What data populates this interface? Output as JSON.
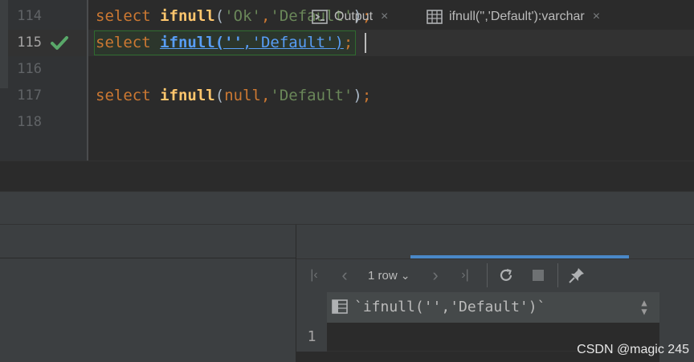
{
  "editor": {
    "lines": [
      {
        "number": "114",
        "tokens": [
          {
            "t": "select",
            "c": "kw"
          },
          {
            "t": " ",
            "c": "punc"
          },
          {
            "t": "ifnull",
            "c": "fn"
          },
          {
            "t": "(",
            "c": "punc"
          },
          {
            "t": "'Ok'",
            "c": "str"
          },
          {
            "t": ",",
            "c": "kw"
          },
          {
            "t": "'Default'",
            "c": "str"
          },
          {
            "t": ")",
            "c": "punc"
          },
          {
            "t": ";",
            "c": "semi"
          }
        ]
      },
      {
        "number": "115",
        "tokens": [
          {
            "t": "select",
            "c": "kw"
          },
          {
            "t": " ",
            "c": "punc"
          },
          {
            "t": "ifnull(''",
            "c": "fn-link"
          },
          {
            "t": ",",
            "c": "link-seg"
          },
          {
            "t": "'Default')",
            "c": "link-seg"
          },
          {
            "t": ";",
            "c": "semi"
          }
        ]
      },
      {
        "number": "116",
        "tokens": []
      },
      {
        "number": "117",
        "tokens": [
          {
            "t": "select",
            "c": "kw"
          },
          {
            "t": " ",
            "c": "punc"
          },
          {
            "t": "ifnull",
            "c": "fn"
          },
          {
            "t": "(",
            "c": "punc"
          },
          {
            "t": "null",
            "c": "kw"
          },
          {
            "t": ",",
            "c": "kw"
          },
          {
            "t": "'Default'",
            "c": "str"
          },
          {
            "t": ")",
            "c": "punc"
          },
          {
            "t": ";",
            "c": "semi"
          }
        ]
      },
      {
        "number": "118",
        "tokens": []
      }
    ],
    "current_line": "115",
    "run_status_icon": "check-icon"
  },
  "tool_window": {
    "tabs": [
      {
        "label": "Output",
        "icon": "console-output-icon",
        "close": "×"
      },
      {
        "label": "ifnull('','Default'):varchar",
        "icon": "table-grid-icon",
        "close": "×",
        "active": true
      }
    ],
    "toolbar": {
      "first_page": "|‹",
      "prev": "‹",
      "rows": "1 row",
      "rows_chevron": "⌄",
      "next": "›",
      "last_page": "›|",
      "reload_icon": "reload-icon",
      "stop_icon": "stop-icon",
      "pin_icon": "pin-icon"
    },
    "grid": {
      "column_header": "`ifnull('','Default')`",
      "row_numbers": [
        "1"
      ],
      "cells": [
        ""
      ]
    }
  },
  "watermark": "CSDN @magic 245",
  "colors": {
    "keyword": "#cc7832",
    "function": "#ffc66d",
    "string": "#6a8759",
    "link": "#589df6",
    "success": "#59a869",
    "background": "#2b2b2b"
  }
}
